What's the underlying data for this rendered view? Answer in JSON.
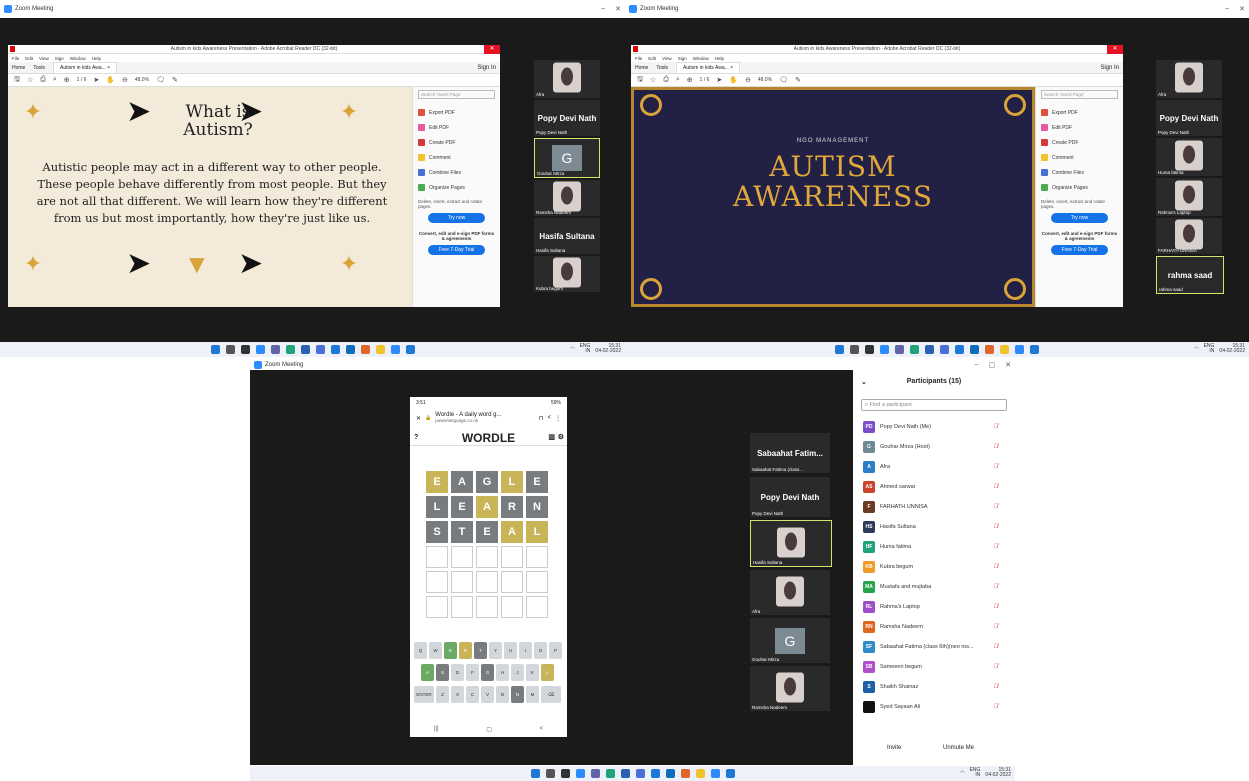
{
  "zoom_title": "Zoom Meeting",
  "acrobat_title": "Autism in kids Awareness Presentation - Adobe Acrobat Reader DC (32-bit)",
  "acrobat_menu": [
    "File",
    "Edit",
    "View",
    "Sign",
    "Window",
    "Help"
  ],
  "acrobat_tabs": {
    "home": "Home",
    "tools": "Tools",
    "doc": "Autism in kids Awa... ×",
    "sign_in": "Sign In"
  },
  "page_counter": "1 / 6",
  "zoom_pct": "48.0%",
  "right_pane": {
    "search": "Search 'Insert Page'",
    "items": [
      "Export PDF",
      "Edit PDF",
      "Create PDF",
      "Comment",
      "Combine Files",
      "Organize Pages"
    ],
    "desc": "Delete, insert, extract and rotate pages.",
    "try": "Try now",
    "promo": "Convert, edit and e-sign PDF forms & agreements",
    "trial": "Free 7-Day Trial"
  },
  "slide1": {
    "title": "What is Autism?",
    "body": "Autistic people may act in a different way to other people. These people behave differently from most people. But they are not all that different. We will learn how they're different from us but most importantly, how they're just like us."
  },
  "slide2": {
    "label": "NGO MANAGEMENT",
    "title1": "AUTISM",
    "title2": "AWARENESS"
  },
  "strip1": {
    "t1": "Afra",
    "t2": "Popy Devi Nath",
    "t2n": "Popy Devi Nath",
    "t3": "Gouhar Mirza",
    "t4": "Ramsha Nadeem",
    "t5": "Hasifa Sultana",
    "t5n": "Hasifa Sultana",
    "t6": "Kubra begum"
  },
  "strip2": {
    "t1": "Afra",
    "t2": "Popy Devi Nath",
    "t2n": "Popy Devi Nath",
    "t3": "Huma fatima",
    "t4": "Rahma's Laptop",
    "t5": "FARHATH UNNISA",
    "t6": "rahma saad",
    "t6n": "rahma saad"
  },
  "taskbar": {
    "lang": "ENG",
    "region": "IN",
    "time": "15:31",
    "date": "04-02-2022"
  },
  "phone": {
    "status": "3:51",
    "battery": "59%",
    "page_title": "Wordle - A daily word g...",
    "url": "powerlanguage.co.uk",
    "app": "WORDLE",
    "rows": [
      [
        "E",
        "A",
        "G",
        "L",
        "E"
      ],
      [
        "L",
        "E",
        "A",
        "R",
        "N"
      ],
      [
        "S",
        "T",
        "E",
        "A",
        "L"
      ]
    ],
    "kb1": [
      "Q",
      "W",
      "E",
      "R",
      "T",
      "Y",
      "U",
      "I",
      "O",
      "P"
    ],
    "kb2": [
      "A",
      "S",
      "D",
      "F",
      "G",
      "H",
      "J",
      "K",
      "L"
    ],
    "kb3": [
      "ENTER",
      "Z",
      "X",
      "C",
      "V",
      "B",
      "N",
      "M",
      "⌫"
    ]
  },
  "strip3": {
    "t1": "Sabaahat Fatim...",
    "t1n": "Sabaahat Fatima (class...",
    "t2": "Popy Devi Nath",
    "t2n": "Popy Devi Nath",
    "t3": "Hasifa Sultana",
    "t4": "Afra",
    "t5": "Gouhar Mirza",
    "t6": "Ramsha Nadeem"
  },
  "participants": {
    "header": "Participants (15)",
    "search": "Find a participant",
    "list": [
      {
        "i": "PD",
        "n": "Popy Devi Nath (Me)",
        "c": "#7b4fc9"
      },
      {
        "i": "G",
        "n": "Gouhar Mirza (Host)",
        "c": "#6f8a96"
      },
      {
        "i": "A",
        "n": "Afra",
        "c": "#2d7ec9"
      },
      {
        "i": "AS",
        "n": "Ahmed sarwar",
        "c": "#c9432d"
      },
      {
        "i": "F",
        "n": "FARHATH UNNISA",
        "c": "#6a3c22"
      },
      {
        "i": "HS",
        "n": "Hasifa Sultana",
        "c": "#2b3a5a"
      },
      {
        "i": "HF",
        "n": "Huma fatima",
        "c": "#1fa37a"
      },
      {
        "i": "KB",
        "n": "Kubra begum",
        "c": "#f09a28"
      },
      {
        "i": "MA",
        "n": "Mustafa and mujtaba",
        "c": "#27a34e"
      },
      {
        "i": "RL",
        "n": "Rahma's Laptop",
        "c": "#9b4fc9"
      },
      {
        "i": "RN",
        "n": "Ramsha Nadeem",
        "c": "#e0661f"
      },
      {
        "i": "SF",
        "n": "Sabaahat Fatima (class 6th)(neo ros...",
        "c": "#2d8cc9"
      },
      {
        "i": "SB",
        "n": "Sameeen begum",
        "c": "#b04fc9"
      },
      {
        "i": "S",
        "n": "Shaikh Shainaz",
        "c": "#1f5fa3"
      },
      {
        "i": "",
        "n": "Syed Sayaan Ali",
        "c": "#111111"
      }
    ],
    "invite": "Invite",
    "unmute": "Unmute Me"
  }
}
